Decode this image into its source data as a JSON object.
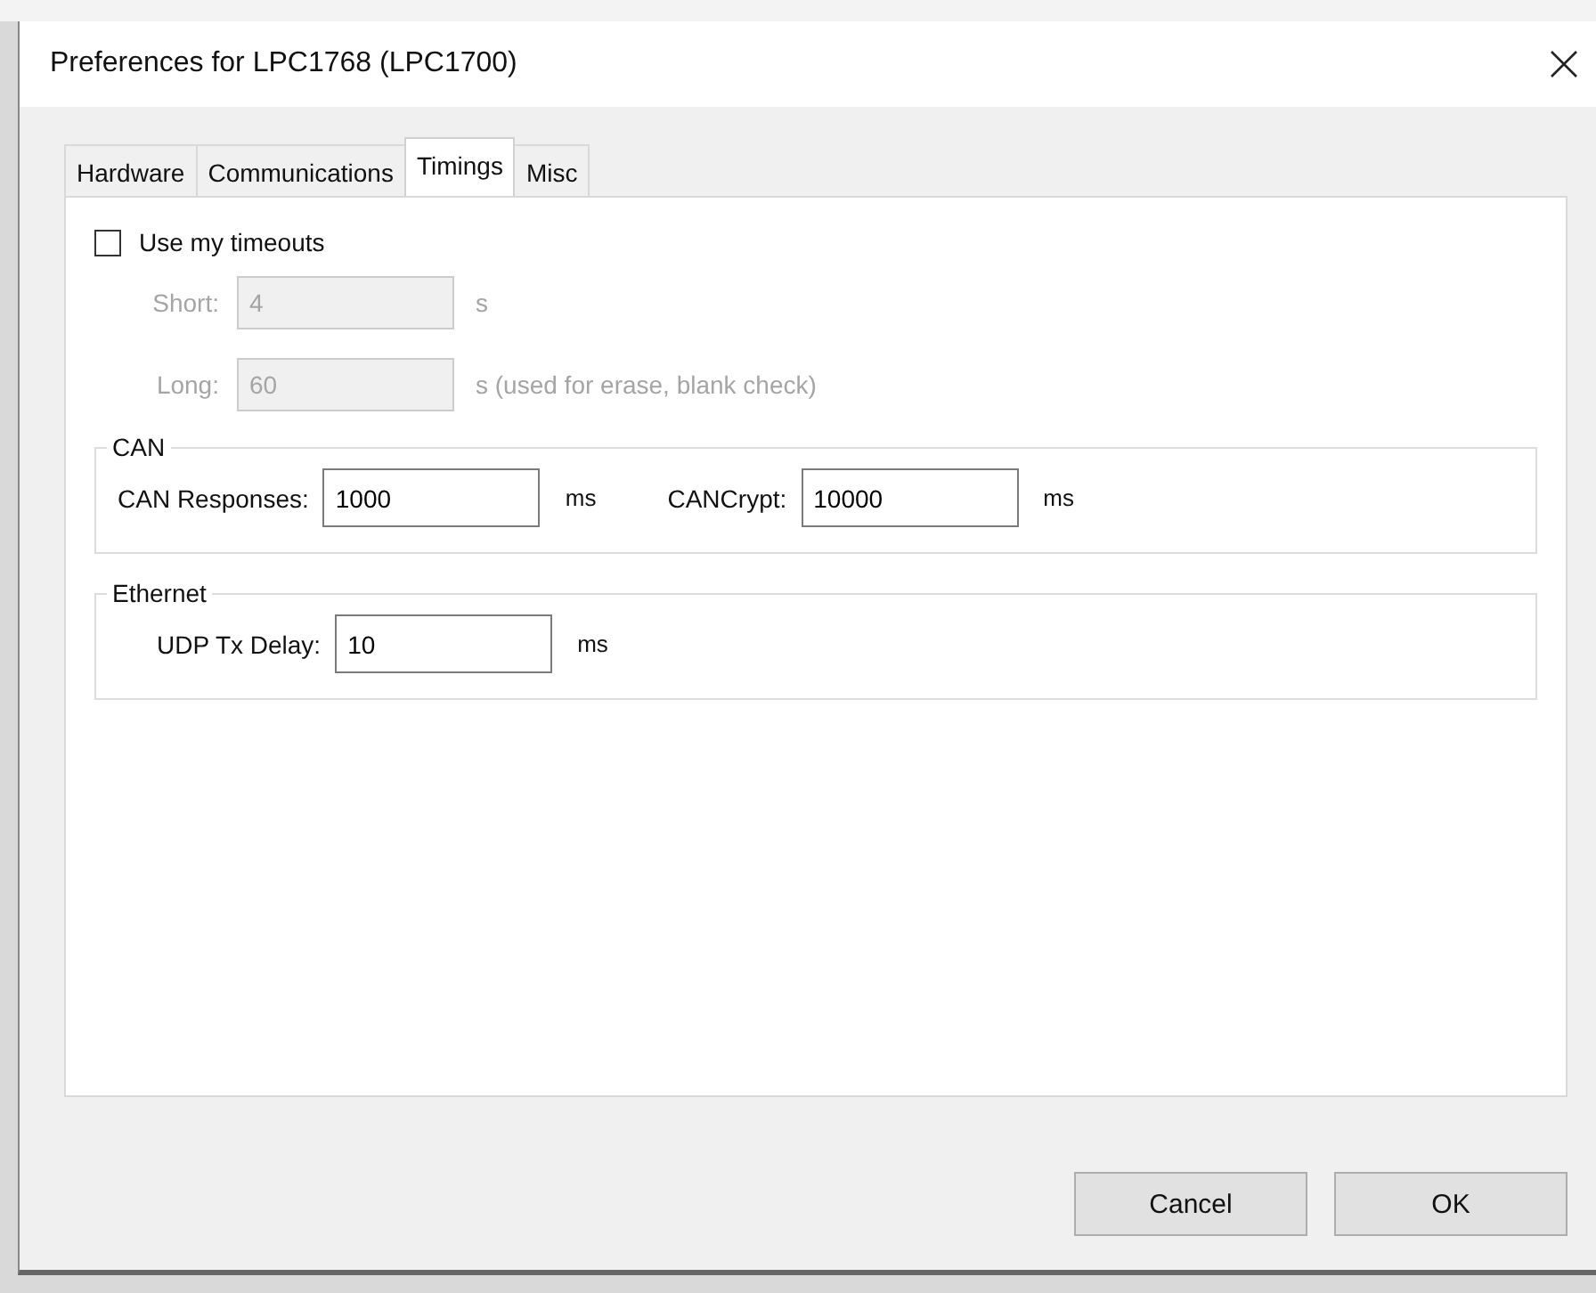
{
  "window": {
    "title": "Preferences for LPC1768 (LPC1700)"
  },
  "tabs": [
    {
      "label": "Hardware",
      "selected": false
    },
    {
      "label": "Communications",
      "selected": false
    },
    {
      "label": "Timings",
      "selected": true
    },
    {
      "label": "Misc",
      "selected": false
    }
  ],
  "use_timeouts": {
    "label": "Use my timeouts",
    "checked": false
  },
  "timeouts": [
    {
      "label": "Short:",
      "value": "4",
      "unit": "s",
      "disabled": true
    },
    {
      "label": "Long:",
      "value": "60",
      "unit": "s (used for erase, blank check)",
      "disabled": true
    }
  ],
  "groups": [
    {
      "title": "CAN",
      "fields": [
        {
          "label": "CAN Responses:",
          "value": "1000",
          "unit": "ms"
        },
        {
          "label": "CANCrypt:",
          "value": "10000",
          "unit": "ms"
        }
      ]
    },
    {
      "title": "Ethernet",
      "fields": [
        {
          "label": "UDP Tx Delay:",
          "value": "10",
          "unit": "ms"
        }
      ]
    }
  ],
  "buttons": [
    "Cancel",
    "OK"
  ]
}
